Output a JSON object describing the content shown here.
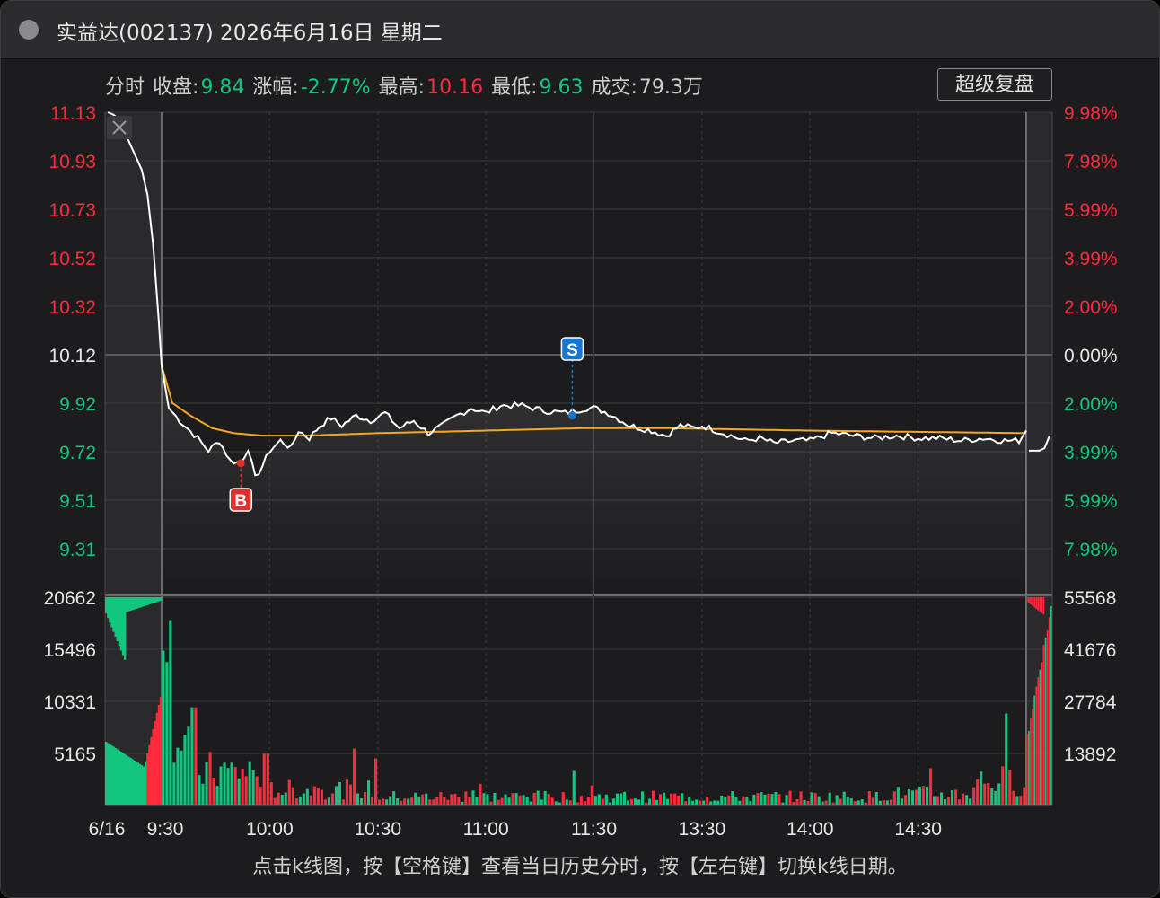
{
  "title": "实益达(002137) 2026年6月16日 星期二",
  "info": {
    "mode": "分时",
    "close_label": "收盘:",
    "close_value": "9.84",
    "change_label": "涨幅:",
    "change_value": "-2.77%",
    "high_label": "最高:",
    "high_value": "10.16",
    "low_label": "最低:",
    "low_value": "9.63",
    "volume_label": "成交:",
    "volume_value": "79.3万"
  },
  "replay_button": "超级复盘",
  "footer_hint": "点击k线图，按【空格键】查看当日历史分时，按【左右键】切换k线日期。",
  "colors": {
    "up": "#ff2a3b",
    "down": "#12c77d",
    "price_line": "#ffffff",
    "avg_line": "#f5a623",
    "buy_marker": "#e0312b",
    "sell_marker": "#1677d2"
  },
  "chart_data": {
    "type": "line",
    "price_axis_left": [
      "11.13",
      "10.93",
      "10.73",
      "10.52",
      "10.32",
      "10.12",
      "9.92",
      "9.72",
      "9.51",
      "9.31"
    ],
    "price_axis_right": [
      "9.98%",
      "7.98%",
      "5.99%",
      "3.99%",
      "2.00%",
      "0.00%",
      "2.00%",
      "3.99%",
      "5.99%",
      "7.98%"
    ],
    "price_axis_colors": [
      "up",
      "up",
      "up",
      "up",
      "up",
      "neutral",
      "down",
      "down",
      "down",
      "down"
    ],
    "volume_axis_left": [
      "20662",
      "15496",
      "10331",
      "5165"
    ],
    "volume_axis_right": [
      "55568",
      "41676",
      "27784",
      "13892"
    ],
    "time_labels": [
      "6/16",
      "9:30",
      "10:00",
      "10:30",
      "11:00",
      "11:30",
      "13:30",
      "14:00",
      "14:30"
    ],
    "prev_close": 10.12,
    "ylim": [
      9.21,
      11.13
    ],
    "volume_max": 20662,
    "call_auction_minutes": 10,
    "session_minutes": 240,
    "post_minutes": 5,
    "call_auction_price": [
      11.13,
      11.12,
      11.1,
      11.05,
      11.0,
      10.95,
      10.9,
      10.8,
      10.6,
      10.3
    ],
    "price_keypoints": [
      [
        0,
        10.12
      ],
      [
        2,
        9.95
      ],
      [
        5,
        9.9
      ],
      [
        10,
        9.83
      ],
      [
        13,
        9.78
      ],
      [
        16,
        9.82
      ],
      [
        19,
        9.74
      ],
      [
        22,
        9.73
      ],
      [
        24,
        9.79
      ],
      [
        26,
        9.67
      ],
      [
        28,
        9.72
      ],
      [
        30,
        9.78
      ],
      [
        33,
        9.82
      ],
      [
        36,
        9.79
      ],
      [
        38,
        9.86
      ],
      [
        41,
        9.83
      ],
      [
        44,
        9.88
      ],
      [
        47,
        9.91
      ],
      [
        50,
        9.88
      ],
      [
        54,
        9.92
      ],
      [
        58,
        9.9
      ],
      [
        62,
        9.93
      ],
      [
        66,
        9.87
      ],
      [
        70,
        9.9
      ],
      [
        74,
        9.85
      ],
      [
        78,
        9.88
      ],
      [
        82,
        9.92
      ],
      [
        86,
        9.95
      ],
      [
        90,
        9.93
      ],
      [
        94,
        9.96
      ],
      [
        100,
        9.96
      ],
      [
        106,
        9.94
      ],
      [
        112,
        9.93
      ],
      [
        118,
        9.95
      ],
      [
        120,
        9.95
      ],
      [
        124,
        9.93
      ],
      [
        130,
        9.88
      ],
      [
        136,
        9.86
      ],
      [
        140,
        9.84
      ],
      [
        144,
        9.88
      ],
      [
        148,
        9.87
      ],
      [
        150,
        9.88
      ],
      [
        154,
        9.86
      ],
      [
        158,
        9.84
      ],
      [
        162,
        9.82
      ],
      [
        166,
        9.83
      ],
      [
        170,
        9.81
      ],
      [
        176,
        9.82
      ],
      [
        180,
        9.82
      ],
      [
        186,
        9.85
      ],
      [
        192,
        9.84
      ],
      [
        198,
        9.83
      ],
      [
        204,
        9.84
      ],
      [
        210,
        9.83
      ],
      [
        216,
        9.83
      ],
      [
        222,
        9.82
      ],
      [
        228,
        9.83
      ],
      [
        234,
        9.82
      ],
      [
        238,
        9.82
      ],
      [
        240,
        9.86
      ]
    ],
    "post_price": [
      9.78,
      9.78,
      9.78,
      9.79,
      9.84
    ],
    "avg_keypoints": [
      [
        0,
        10.12
      ],
      [
        3,
        9.97
      ],
      [
        8,
        9.92
      ],
      [
        14,
        9.87
      ],
      [
        20,
        9.85
      ],
      [
        28,
        9.84
      ],
      [
        40,
        9.84
      ],
      [
        60,
        9.85
      ],
      [
        90,
        9.86
      ],
      [
        118,
        9.87
      ],
      [
        140,
        9.87
      ],
      [
        180,
        9.86
      ],
      [
        240,
        9.85
      ]
    ],
    "buy_marker": {
      "label": "B",
      "minute": 22,
      "price": 9.73
    },
    "sell_marker": {
      "label": "S",
      "minute": 114,
      "price": 9.92
    }
  }
}
